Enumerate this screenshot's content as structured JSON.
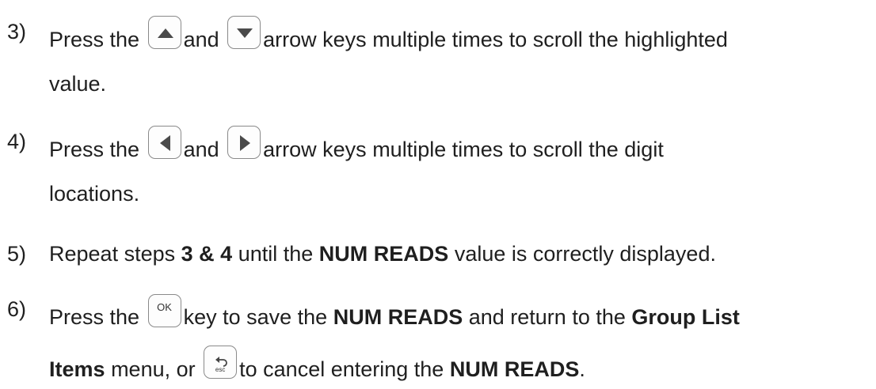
{
  "steps": [
    {
      "number": "3)",
      "line1": {
        "pre": "Press the",
        "mid": "and",
        "post": "arrow keys multiple times to scroll the highlighted"
      },
      "line2": "value.",
      "keys": [
        "up-arrow-key",
        "down-arrow-key"
      ]
    },
    {
      "number": "4)",
      "line1": {
        "pre": "Press the",
        "mid": "and",
        "post": "arrow keys multiple times to scroll the digit"
      },
      "line2": "locations.",
      "keys": [
        "left-arrow-key",
        "right-arrow-key"
      ]
    },
    {
      "number": "5)",
      "parts": {
        "a": "Repeat steps",
        "b": "3 & 4",
        "c": "until the",
        "d": "NUM READS",
        "e": "value is correctly displayed."
      }
    },
    {
      "number": "6)",
      "line1": {
        "a": "Press the",
        "b": "key to save the",
        "c": "NUM READS",
        "d": "and return to the",
        "e": "Group List"
      },
      "line2": {
        "a": "Items",
        "b": "menu, or",
        "c": "to cancel entering the",
        "d": "NUM READS",
        "e": "."
      },
      "keys": {
        "ok_label": "OK",
        "esc_label": "esc"
      }
    }
  ]
}
